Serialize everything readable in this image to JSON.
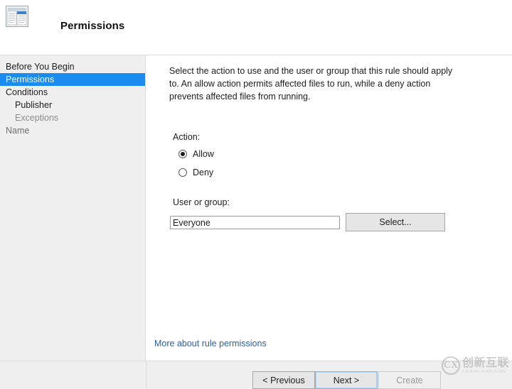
{
  "header": {
    "icon": "wizard-window-icon",
    "title": "Permissions"
  },
  "sidebar": {
    "items": [
      {
        "label": "Before You Begin",
        "state": "normal",
        "indent": false
      },
      {
        "label": "Permissions",
        "state": "selected",
        "indent": false
      },
      {
        "label": "Conditions",
        "state": "normal",
        "indent": false
      },
      {
        "label": "Publisher",
        "state": "normal",
        "indent": true
      },
      {
        "label": "Exceptions",
        "state": "dim",
        "indent": true
      },
      {
        "label": "Name",
        "state": "mid",
        "indent": false
      }
    ]
  },
  "content": {
    "description": "Select the action to use and the user or group that this rule should apply to. An allow action permits affected files to run, while a deny action prevents affected files from running.",
    "action_label": "Action:",
    "radios": [
      {
        "label": "Allow",
        "checked": true
      },
      {
        "label": "Deny",
        "checked": false
      }
    ],
    "user_group_label": "User or group:",
    "user_group_value": "Everyone",
    "user_group_placeholder": "",
    "select_button": "Select...",
    "more_link": "More about rule permissions"
  },
  "footer": {
    "previous_label": "< Previous",
    "next_label": "Next >",
    "create_label": "Create"
  },
  "watermark": {
    "mark": "CX",
    "cn": "创新互联",
    "en": "CXIANG XINHULIAN"
  },
  "colors": {
    "accent": "#1a8bef",
    "link": "#2a63a8",
    "sidebar_bg": "#efefef",
    "panel_bg": "#ffffff",
    "border": "#dcdcdc"
  }
}
